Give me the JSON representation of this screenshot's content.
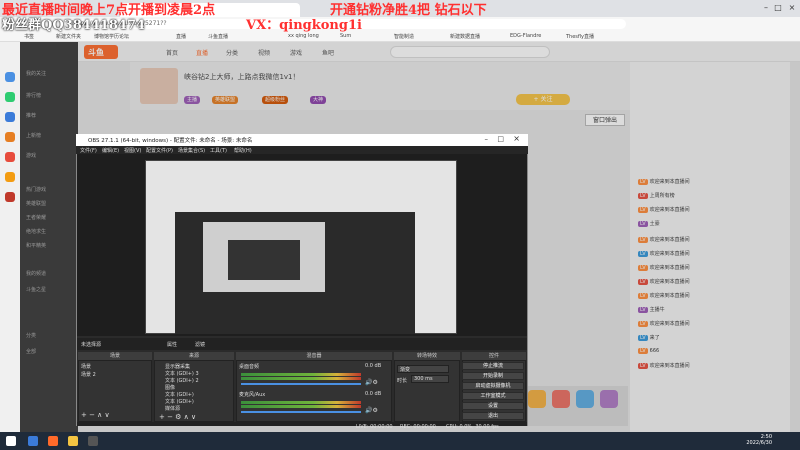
{
  "browser": {
    "url": "https://www.douyu.com/5271??",
    "bookmarks": [
      "书签",
      "新建文件夹",
      "博物馆学历论坛",
      "直播",
      "斗鱼直播",
      "xx qing long",
      "Sum",
      "智能制造",
      "新建数据直播",
      "EDG-Flandre",
      "Thesfly直播"
    ]
  },
  "douyu": {
    "logo": "斗鱼",
    "nav": [
      "首页",
      "直播",
      "分类",
      "视频",
      "游戏",
      "鱼吧"
    ],
    "sidebar": [
      "我的关注",
      "排行榜",
      "推荐",
      "上新榜",
      "游戏",
      "热门游戏",
      "英雄联盟",
      "王者荣耀",
      "绝地求生",
      "和平精英",
      "我的频道",
      "斗鱼之星",
      "分类",
      "全部"
    ],
    "room_title": "峡谷钻2上大师，上路点我微信1v1！",
    "badges": [
      "主播",
      "英雄联盟",
      "超级粉丝",
      "大神"
    ],
    "follow_label": "+ 关注",
    "popout_label": "窗口弹出",
    "chat": [
      "欢迎来到本直播间",
      "上周所有榜",
      "欢迎来到本直播间",
      "土豪",
      "欢迎来到本直播间",
      "欢迎来到本直播间",
      "欢迎来到本直播间",
      "欢迎来到本直播间",
      "欢迎来到本直播间",
      "主播牛",
      "欢迎来到本直播间",
      "来了",
      "666",
      "欢迎来到本直播间"
    ]
  },
  "overlays": {
    "line1": "最近直播时间晚上7点开播到凌晨2点",
    "line2_left": "粉丝群QQ384418474",
    "line2_mid": "VX：qingkong1i",
    "line1_right": "开通钻粉净胜4把 钻石以下",
    "colors": {
      "line1": "#ff3030",
      "vx": "#ff3030",
      "line1_right": "#ff3030",
      "qq": "#ffffff"
    }
  },
  "obs": {
    "title": "OBS 27.1.1 (64-bit, windows) - 配置文件: 未命名 - 场景: 未命名",
    "menu": [
      "文件(F)",
      "编辑(E)",
      "视图(V)",
      "配置文件(P)",
      "场景集合(S)",
      "工具(T)",
      "帮助(H)"
    ],
    "status_label": "未选择源",
    "props_label": "属性",
    "filters_label": "滤镜",
    "docks": {
      "scenes": "场景",
      "sources": "来源",
      "mixer": "混音器",
      "transitions": "转场特效",
      "controls": "控件"
    },
    "scenes": [
      "场景",
      "场景 2"
    ],
    "sources": [
      "显示器采集",
      "文本 (GDI+) 3",
      "文本 (GDI+) 2",
      "图像",
      "文本 (GDI+)",
      "文本 (GDI+)",
      "媒体源"
    ],
    "mixer": [
      {
        "name": "桌面音频",
        "db": "0.0 dB"
      },
      {
        "name": "麦克风/Aux",
        "db": "0.0 dB"
      }
    ],
    "transition": {
      "value": "渐变",
      "duration_label": "时长",
      "duration": "300 ms"
    },
    "controls": [
      "停止推流",
      "开始录制",
      "启动虚拟摄像机",
      "工作室模式",
      "设置",
      "退出"
    ],
    "statusbar": {
      "live": "LIVE: 00:00:00",
      "rec": "REC: 00:00:00",
      "cpu": "CPU: 0.0%, 30.00 fps"
    }
  },
  "taskbar": {
    "time": "2:50",
    "date": "2022/6/30"
  }
}
